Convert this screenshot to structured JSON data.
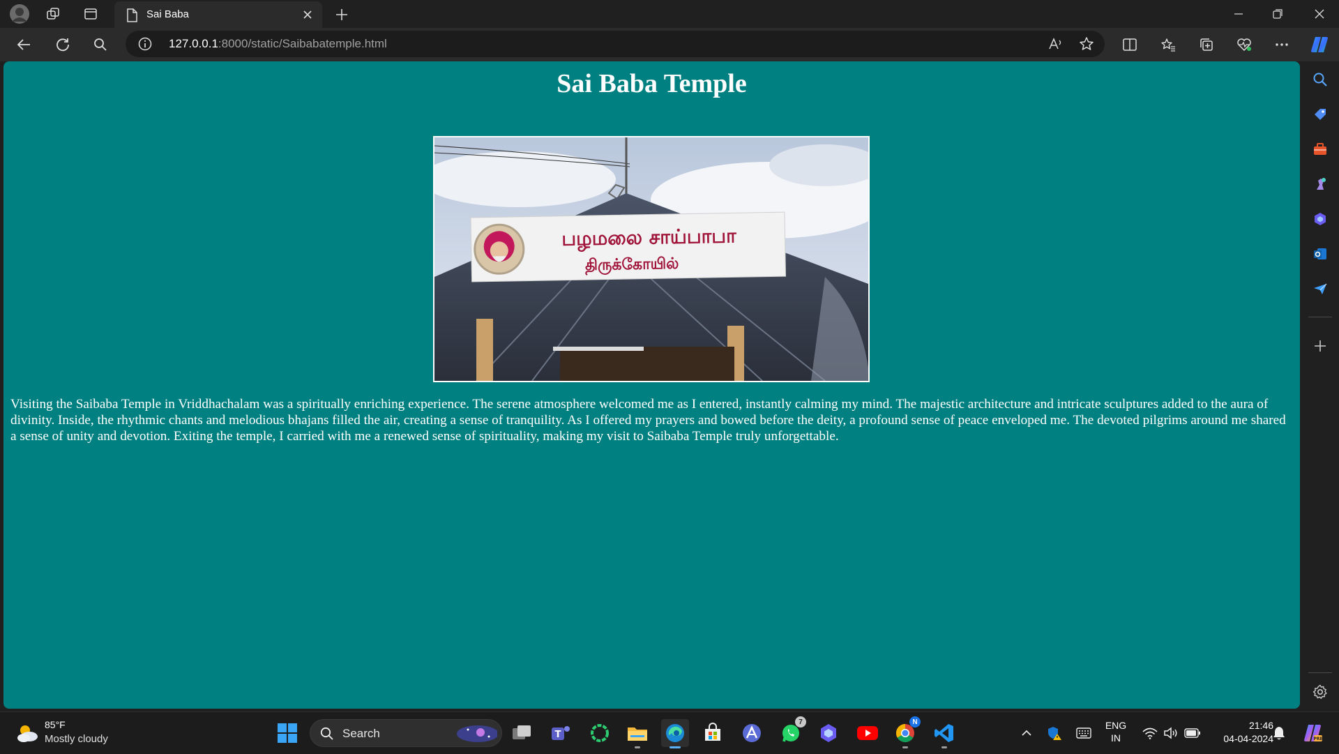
{
  "browser": {
    "tab": {
      "title": "Sai Baba"
    },
    "address_bar": {
      "url_host": "127.0.0.1",
      "url_rest": ":8000/static/Saibabatemple.html"
    }
  },
  "page": {
    "heading": "Sai Baba Temple",
    "image": {
      "signboard_line1": "பழமலை சாய்பாபா",
      "signboard_line2": "திருக்கோயில்"
    },
    "paragraph": "Visiting the Saibaba Temple in Vriddhachalam was a spiritually enriching experience. The serene atmosphere welcomed me as I entered, instantly calming my mind. The majestic architecture and intricate sculptures added to the aura of divinity. Inside, the rhythmic chants and melodious bhajans filled the air, creating a sense of tranquility. As I offered my prayers and bowed before the deity, a profound sense of peace enveloped me. The devoted pilgrims around me shared a sense of unity and devotion. Exiting the temple, I carried with me a renewed sense of spirituality, making my visit to Saibaba Temple truly unforgettable."
  },
  "taskbar": {
    "weather": {
      "temp": "85°F",
      "desc": "Mostly cloudy"
    },
    "search_label": "Search",
    "whatsapp_badge": "7",
    "chrome_badge": "N",
    "language": {
      "line1": "ENG",
      "line2": "IN"
    },
    "clock": {
      "time": "21:46",
      "date": "04-04-2024"
    }
  },
  "colors": {
    "page_bg": "#008080",
    "chrome_bg": "#202020",
    "toolbar_bg": "#2b2b2b"
  }
}
